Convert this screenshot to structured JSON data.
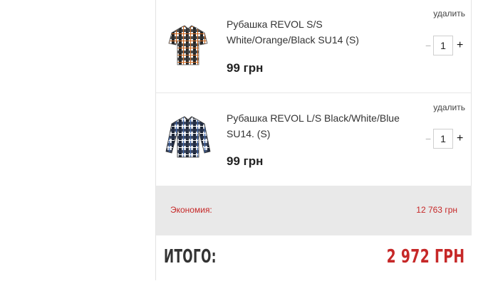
{
  "cart": {
    "items": [
      {
        "title": "Рубашка REVOL S/S White/Orange/Black SU14 (S)",
        "price": "99 грн",
        "remove_label": "удалить",
        "quantity": "1",
        "minus_label": "−",
        "plus_label": "+",
        "image_icon": "shirt-short-sleeve-plaid-icon"
      },
      {
        "title": "Рубашка REVOL L/S Black/White/Blue SU14. (S)",
        "price": "99 грн",
        "remove_label": "удалить",
        "quantity": "1",
        "minus_label": "−",
        "plus_label": "+",
        "image_icon": "shirt-long-sleeve-plaid-icon"
      }
    ],
    "savings": {
      "label": "Экономия:",
      "value": "12 763 грн"
    },
    "total": {
      "label": "ИТОГО:",
      "value": "2 972 ГРН"
    }
  },
  "colors": {
    "accent": "#c62828",
    "savings_bg": "#e9e9e9",
    "border": "#e3e3e3"
  }
}
